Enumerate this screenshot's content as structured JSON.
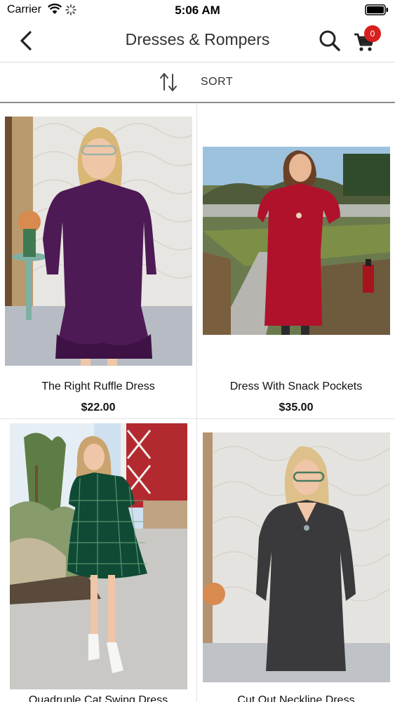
{
  "status_bar": {
    "carrier": "Carrier",
    "time": "5:06 AM"
  },
  "header": {
    "title": "Dresses & Rompers",
    "cart_count": "0"
  },
  "sort": {
    "label": "SORT"
  },
  "icons": {
    "back": "chevron-left-icon",
    "search": "search-icon",
    "cart": "cart-icon",
    "sort": "sort-arrows-icon"
  },
  "colors": {
    "badge": "#d81e1e"
  },
  "products": [
    {
      "name": "The Right Ruffle Dress",
      "price": "$22.00",
      "dress_color": "#4e1a55"
    },
    {
      "name": "Dress With Snack Pockets",
      "price": "$35.00",
      "dress_color": "#b0122c"
    },
    {
      "name": "Quadruple Cat Swing Dress",
      "price": "",
      "dress_color": "#0f4a35"
    },
    {
      "name": "Cut Out Neckline Dress",
      "price": "",
      "dress_color": "#3a3a3c"
    }
  ]
}
